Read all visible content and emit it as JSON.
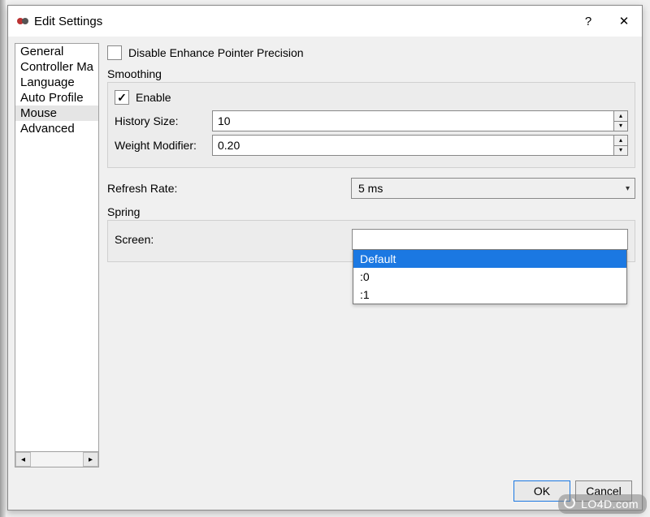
{
  "window": {
    "title": "Edit Settings",
    "help_icon": "?",
    "close_icon": "✕"
  },
  "sidebar": {
    "items": [
      {
        "label": "General",
        "selected": false
      },
      {
        "label": "Controller Ma",
        "selected": false
      },
      {
        "label": "Language",
        "selected": false
      },
      {
        "label": "Auto Profile",
        "selected": false
      },
      {
        "label": "Mouse",
        "selected": true
      },
      {
        "label": "Advanced",
        "selected": false
      }
    ]
  },
  "main": {
    "disable_epp": {
      "label": "Disable Enhance Pointer Precision",
      "checked": false
    },
    "smoothing": {
      "title": "Smoothing",
      "enable": {
        "label": "Enable",
        "checked": true
      },
      "history_size": {
        "label": "History Size:",
        "value": "10"
      },
      "weight_modifier": {
        "label": "Weight Modifier:",
        "value": "0.20"
      }
    },
    "refresh_rate": {
      "label": "Refresh Rate:",
      "value": "5 ms"
    },
    "spring": {
      "title": "Spring",
      "screen": {
        "label": "Screen:",
        "options": [
          {
            "label": "Default",
            "highlighted": true
          },
          {
            "label": ":0",
            "highlighted": false
          },
          {
            "label": ":1",
            "highlighted": false
          }
        ]
      }
    }
  },
  "footer": {
    "ok": "OK",
    "cancel": "Cancel"
  },
  "watermark": "LO4D.com"
}
